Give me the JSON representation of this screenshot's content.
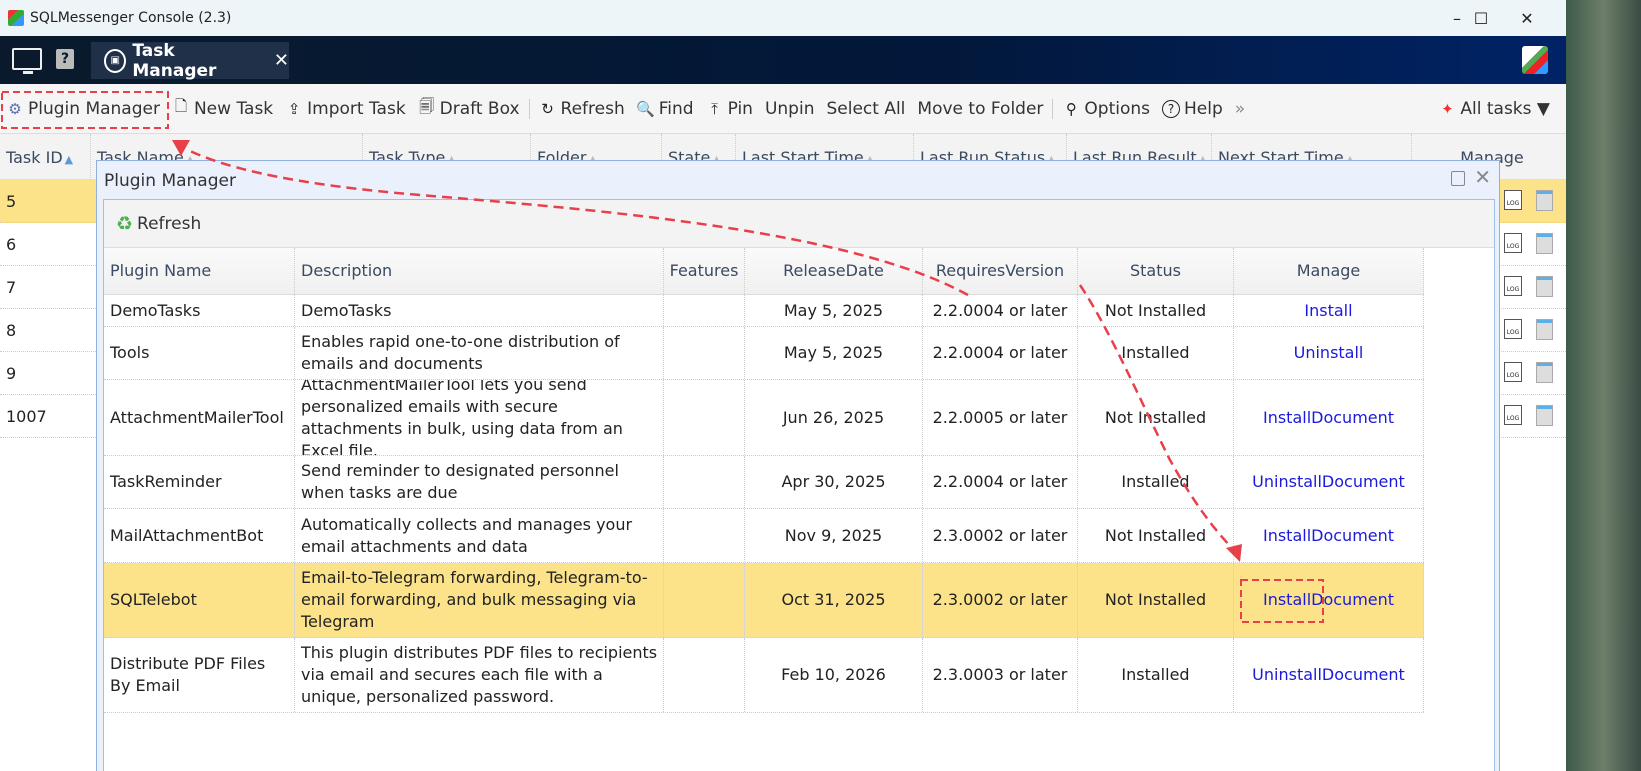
{
  "window": {
    "title": "SQLMessenger Console (2.3)",
    "minimize": "–",
    "maximize": "☐",
    "close": "✕"
  },
  "header": {
    "tab_label": "Task Manager",
    "tab_close": "✕",
    "help": "?"
  },
  "toolbar": {
    "items": [
      {
        "label": "Plugin Manager",
        "icon": "plugin-icon",
        "glyph": "⚙"
      },
      {
        "label": "New Task",
        "icon": "new-task-icon",
        "glyph": "🗋"
      },
      {
        "label": "Import Task",
        "icon": "import-icon",
        "glyph": "⇪"
      },
      {
        "label": "Draft Box",
        "icon": "draft-box-icon",
        "glyph": "🗐"
      },
      {
        "sep": true
      },
      {
        "label": "Refresh",
        "icon": "refresh-icon",
        "glyph": "↻"
      },
      {
        "label": "Find",
        "icon": "search-icon",
        "glyph": "🔍"
      },
      {
        "label": "Pin",
        "icon": "pin-icon",
        "glyph": "⤒"
      },
      {
        "label": "Unpin"
      },
      {
        "label": "Select All"
      },
      {
        "label": "Move to Folder"
      },
      {
        "sep": true
      },
      {
        "label": "Options",
        "icon": "options-icon",
        "glyph": "⚲"
      },
      {
        "label": "Help",
        "icon": "help-icon",
        "glyph": "?"
      },
      {
        "label": "»",
        "icon": "more"
      }
    ],
    "filter": "All tasks ▼"
  },
  "grid": {
    "columns": [
      "Task ID",
      "Task Name",
      "Task Type",
      "Folder",
      "State",
      "Last Start Time",
      "Last Run Status",
      "Last Run Result",
      "Next Start Time",
      "Manage"
    ],
    "rows": [
      "5",
      "6",
      "7",
      "8",
      "9",
      "1007"
    ],
    "log_label": "LOG"
  },
  "dialog": {
    "title": "Plugin Manager",
    "refresh": "Refresh",
    "columns": [
      "Plugin Name",
      "Description",
      "Features",
      "ReleaseDate",
      "RequiresVersion",
      "Status",
      "Manage"
    ],
    "rows": [
      {
        "name": "DemoTasks",
        "desc": "DemoTasks",
        "features": "",
        "date": "May 5, 2025",
        "ver": "2.2.0004 or later",
        "status": "Not Installed",
        "action": "Install",
        "doc": ""
      },
      {
        "name": "Tools",
        "desc": "Enables rapid one-to-one distribution of emails and documents",
        "features": "",
        "date": "May 5, 2025",
        "ver": "2.2.0004 or later",
        "status": "Installed",
        "action": "Uninstall",
        "doc": ""
      },
      {
        "name": "AttachmentMailerTool",
        "desc": "AttachmentMailerTool lets you send personalized emails with secure attachments in bulk, using data from an Excel file.",
        "features": "",
        "date": "Jun 26, 2025",
        "ver": "2.2.0005 or later",
        "status": "Not Installed",
        "action": "Install",
        "doc": "Document"
      },
      {
        "name": "TaskReminder",
        "desc": "Send reminder to designated personnel when tasks are due",
        "features": "",
        "date": "Apr 30, 2025",
        "ver": "2.2.0004 or later",
        "status": "Installed",
        "action": "Uninstall",
        "doc": "Document"
      },
      {
        "name": "MailAttachmentBot",
        "desc": "Automatically collects and manages your email attachments and data",
        "features": "",
        "date": "Nov 9, 2025",
        "ver": "2.3.0002 or later",
        "status": "Not Installed",
        "action": "Install",
        "doc": "Document"
      },
      {
        "name": "SQLTelebot",
        "desc": "Email-to-Telegram forwarding, Telegram-to-email forwarding, and bulk messaging via Telegram",
        "features": "",
        "date": "Oct 31, 2025",
        "ver": "2.3.0002 or later",
        "status": "Not Installed",
        "action": "Install",
        "doc": "Document",
        "selected": true
      },
      {
        "name": "Distribute PDF Files By Email",
        "desc": "This plugin distributes PDF files to recipients via email and secures each file with a unique, personalized password.",
        "features": "",
        "date": "Feb 10, 2026",
        "ver": "2.3.0003 or later",
        "status": "Installed",
        "action": "Uninstall",
        "doc": "Document"
      }
    ]
  },
  "colors": {
    "accent": "#1a1adc",
    "selected_row": "#fce38a",
    "annotation": "#e8404a"
  }
}
